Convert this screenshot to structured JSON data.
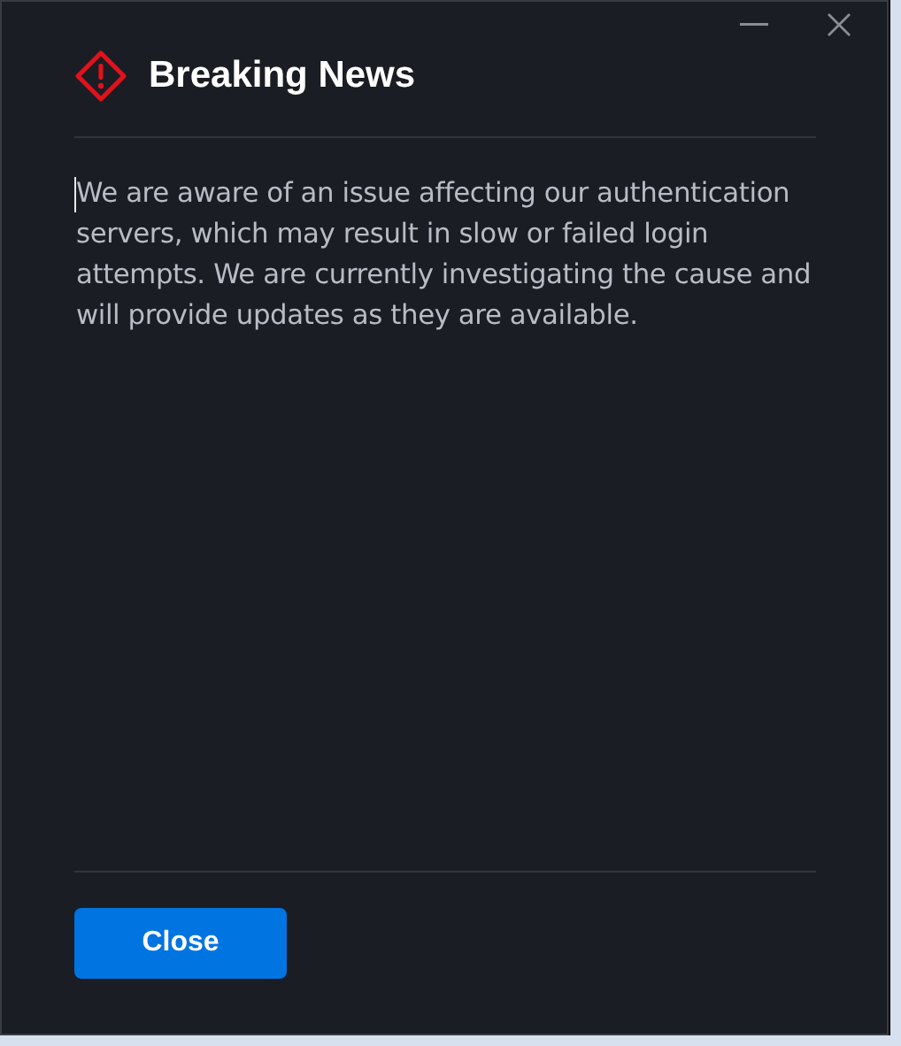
{
  "window": {
    "controls": [
      {
        "kind": "minimize"
      },
      {
        "kind": "close"
      }
    ]
  },
  "dialog": {
    "title": "Breaking News",
    "message": "We are aware of an issue affecting our authentication servers, which may result in slow or failed login attempts. We are currently investigating the cause and will provide updates as they are available.",
    "buttons": [
      "Close"
    ]
  }
}
